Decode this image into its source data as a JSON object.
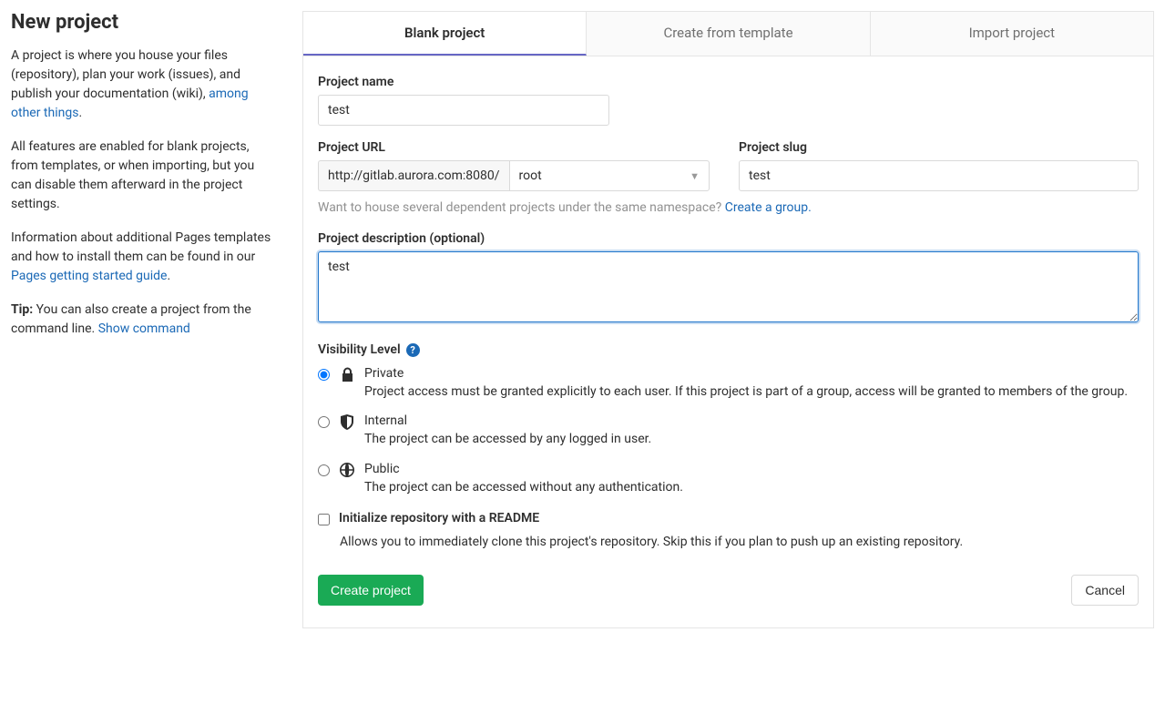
{
  "sidebar": {
    "title": "New project",
    "p1a": "A project is where you house your files (repository), plan your work (issues), and publish your documentation (wiki), ",
    "p1link": "among other things",
    "p1b": ".",
    "p2": "All features are enabled for blank projects, from templates, or when importing, but you can disable them afterward in the project settings.",
    "p3a": "Information about additional Pages templates and how to install them can be found in our ",
    "p3link": "Pages getting started guide",
    "p3b": ".",
    "tip_label": "Tip:",
    "tip_text": " You can also create a project from the command line. ",
    "tip_link": "Show command"
  },
  "tabs": {
    "blank": "Blank project",
    "template": "Create from template",
    "import": "Import project"
  },
  "form": {
    "name_label": "Project name",
    "name_value": "test",
    "url_label": "Project URL",
    "url_prefix": "http://gitlab.aurora.com:8080/",
    "url_namespace": "root",
    "slug_label": "Project slug",
    "slug_value": "test",
    "namespace_hint": "Want to house several dependent projects under the same namespace? ",
    "namespace_link": "Create a group.",
    "desc_label": "Project description (optional)",
    "desc_value": "test",
    "visibility_label": "Visibility Level",
    "vis_private_title": "Private",
    "vis_private_desc": "Project access must be granted explicitly to each user. If this project is part of a group, access will be granted to members of the group.",
    "vis_internal_title": "Internal",
    "vis_internal_desc": "The project can be accessed by any logged in user.",
    "vis_public_title": "Public",
    "vis_public_desc": "The project can be accessed without any authentication.",
    "readme_label": "Initialize repository with a README",
    "readme_desc": "Allows you to immediately clone this project's repository. Skip this if you plan to push up an existing repository.",
    "create_btn": "Create project",
    "cancel_btn": "Cancel"
  }
}
